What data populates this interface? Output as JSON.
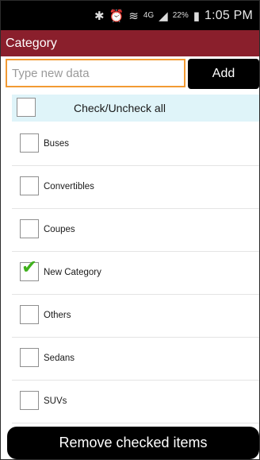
{
  "status_bar": {
    "icons": [
      "bluetooth-icon",
      "alarm-icon",
      "wifi-icon",
      "signal-icon",
      "battery-icon"
    ],
    "network_label": "4G",
    "battery": "22%",
    "time": "1:05 PM"
  },
  "app": {
    "title": "Category",
    "accent_color": "#8a1f2c"
  },
  "input": {
    "placeholder": "Type new data",
    "value": "",
    "focus_color": "#f29a33"
  },
  "add_button": {
    "label": "Add"
  },
  "check_all": {
    "label": "Check/Uncheck all",
    "checked": false
  },
  "items": [
    {
      "label": "Buses",
      "checked": false
    },
    {
      "label": "Convertibles",
      "checked": false
    },
    {
      "label": "Coupes",
      "checked": false
    },
    {
      "label": "New Category",
      "checked": true
    },
    {
      "label": "Others",
      "checked": false
    },
    {
      "label": "Sedans",
      "checked": false
    },
    {
      "label": "SUVs",
      "checked": false
    }
  ],
  "remove_button": {
    "label": "Remove checked items"
  }
}
